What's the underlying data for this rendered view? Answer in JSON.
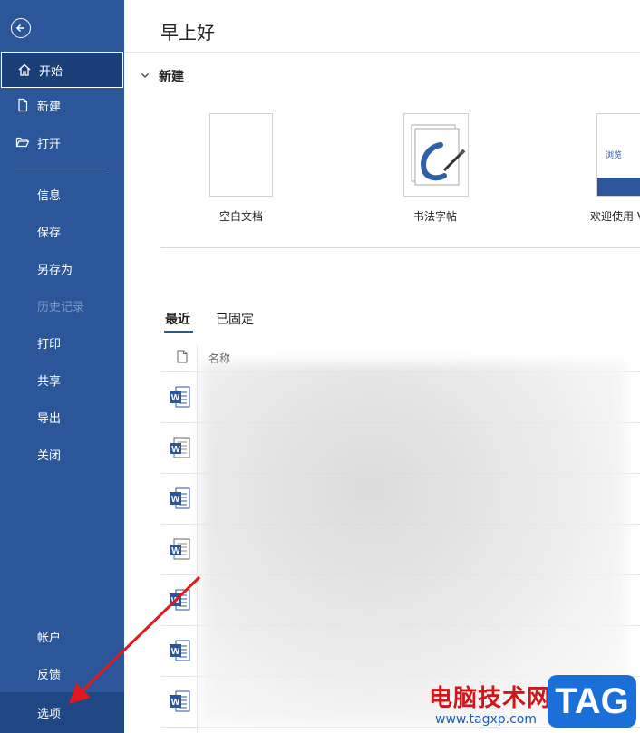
{
  "sidebar": {
    "items": [
      {
        "label": "开始",
        "icon": "home-icon"
      },
      {
        "label": "新建",
        "icon": "new-doc-icon"
      },
      {
        "label": "打开",
        "icon": "folder-open-icon"
      },
      {
        "label": "信息"
      },
      {
        "label": "保存"
      },
      {
        "label": "另存为"
      },
      {
        "label": "历史记录"
      },
      {
        "label": "打印"
      },
      {
        "label": "共享"
      },
      {
        "label": "导出"
      },
      {
        "label": "关闭"
      },
      {
        "label": "帐户"
      },
      {
        "label": "反馈"
      },
      {
        "label": "选项"
      }
    ],
    "accent": "#2b579a"
  },
  "main": {
    "greeting": "早上好",
    "new_section": {
      "title": "新建",
      "templates": [
        {
          "label": "空白文档"
        },
        {
          "label": "书法字帖"
        },
        {
          "label": "欢迎使用 V",
          "thumb_text": "浏览"
        }
      ]
    },
    "tabs": [
      {
        "label": "最近"
      },
      {
        "label": "已固定"
      }
    ],
    "columns": {
      "name": "名称"
    }
  },
  "watermark": {
    "cn": "电脑技术网",
    "url": "www.tagxp.com",
    "tag": "TAG"
  }
}
